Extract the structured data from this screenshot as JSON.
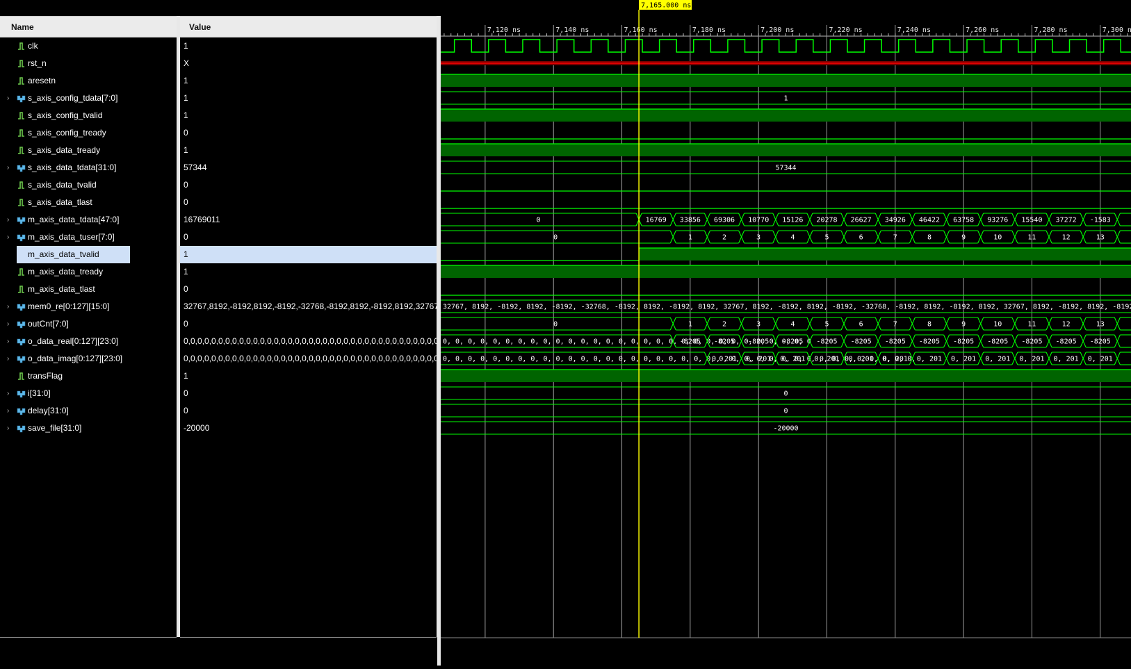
{
  "columns": {
    "name": "Name",
    "value": "Value"
  },
  "cursor": {
    "time": 7165,
    "label": "7,165.000 ns"
  },
  "time_axis": {
    "start": 7107,
    "end": 7309,
    "unit": "ns",
    "major_ticks": [
      {
        "t": 7120,
        "label": "7,120 ns"
      },
      {
        "t": 7140,
        "label": "7,140 ns"
      },
      {
        "t": 7160,
        "label": "7,160 ns"
      },
      {
        "t": 7180,
        "label": "7,180 ns"
      },
      {
        "t": 7200,
        "label": "7,200 ns"
      },
      {
        "t": 7220,
        "label": "7,220 ns"
      },
      {
        "t": 7240,
        "label": "7,240 ns"
      },
      {
        "t": 7260,
        "label": "7,260 ns"
      },
      {
        "t": 7280,
        "label": "7,280 ns"
      },
      {
        "t": 7300,
        "label": "7,300 ns"
      }
    ]
  },
  "colors": {
    "wave": "#00ff00",
    "high_fill": "#006400",
    "unknown": "#ff0000",
    "cursor": "#ffff00",
    "selection": "#cfe0f7"
  },
  "signals": [
    {
      "name": "clk",
      "value": "1",
      "kind": "bit",
      "expandable": false,
      "wave": {
        "type": "clock",
        "period": 10,
        "first_rise": 7111
      }
    },
    {
      "name": "rst_n",
      "value": "X",
      "kind": "bit",
      "expandable": false,
      "wave": {
        "type": "unknown"
      }
    },
    {
      "name": "aresetn",
      "value": "1",
      "kind": "bit",
      "expandable": false,
      "wave": {
        "type": "level",
        "segments": [
          {
            "t": 7107,
            "v": 1
          }
        ]
      }
    },
    {
      "name": "s_axis_config_tdata[7:0]",
      "value": "1",
      "kind": "bus",
      "expandable": true,
      "wave": {
        "type": "bus",
        "segments": [
          {
            "t": 7107,
            "label": "1"
          }
        ]
      }
    },
    {
      "name": "s_axis_config_tvalid",
      "value": "1",
      "kind": "bit",
      "expandable": false,
      "wave": {
        "type": "level",
        "segments": [
          {
            "t": 7107,
            "v": 1
          }
        ]
      }
    },
    {
      "name": "s_axis_config_tready",
      "value": "0",
      "kind": "bit",
      "expandable": false,
      "wave": {
        "type": "level",
        "segments": [
          {
            "t": 7107,
            "v": 0
          }
        ]
      }
    },
    {
      "name": "s_axis_data_tready",
      "value": "1",
      "kind": "bit",
      "expandable": false,
      "wave": {
        "type": "level",
        "segments": [
          {
            "t": 7107,
            "v": 1
          }
        ]
      }
    },
    {
      "name": "s_axis_data_tdata[31:0]",
      "value": "57344",
      "kind": "bus",
      "expandable": true,
      "wave": {
        "type": "bus",
        "segments": [
          {
            "t": 7107,
            "label": "57344"
          }
        ]
      }
    },
    {
      "name": "s_axis_data_tvalid",
      "value": "0",
      "kind": "bit",
      "expandable": false,
      "wave": {
        "type": "level",
        "segments": [
          {
            "t": 7107,
            "v": 0
          }
        ]
      }
    },
    {
      "name": "s_axis_data_tlast",
      "value": "0",
      "kind": "bit",
      "expandable": false,
      "wave": {
        "type": "level",
        "segments": [
          {
            "t": 7107,
            "v": 0
          }
        ]
      }
    },
    {
      "name": "m_axis_data_tdata[47:0]",
      "value": "16769011",
      "kind": "bus",
      "expandable": true,
      "wave": {
        "type": "bus",
        "segments": [
          {
            "t": 7107,
            "label": "0"
          },
          {
            "t": 7165,
            "label": "16769"
          },
          {
            "t": 7175,
            "label": "33856"
          },
          {
            "t": 7185,
            "label": "69306"
          },
          {
            "t": 7195,
            "label": "10770"
          },
          {
            "t": 7205,
            "label": "15126"
          },
          {
            "t": 7215,
            "label": "20278"
          },
          {
            "t": 7225,
            "label": "26627"
          },
          {
            "t": 7235,
            "label": "34926"
          },
          {
            "t": 7245,
            "label": "46422"
          },
          {
            "t": 7255,
            "label": "63758"
          },
          {
            "t": 7265,
            "label": "93276"
          },
          {
            "t": 7275,
            "label": "15540"
          },
          {
            "t": 7285,
            "label": "37272"
          },
          {
            "t": 7295,
            "label": "-1583"
          },
          {
            "t": 7305,
            "label": ""
          }
        ]
      }
    },
    {
      "name": "m_axis_data_tuser[7:0]",
      "value": "0",
      "kind": "bus",
      "expandable": true,
      "wave": {
        "type": "bus",
        "segments": [
          {
            "t": 7107,
            "label": "0"
          },
          {
            "t": 7175,
            "label": "1"
          },
          {
            "t": 7185,
            "label": "2"
          },
          {
            "t": 7195,
            "label": "3"
          },
          {
            "t": 7205,
            "label": "4"
          },
          {
            "t": 7215,
            "label": "5"
          },
          {
            "t": 7225,
            "label": "6"
          },
          {
            "t": 7235,
            "label": "7"
          },
          {
            "t": 7245,
            "label": "8"
          },
          {
            "t": 7255,
            "label": "9"
          },
          {
            "t": 7265,
            "label": "10"
          },
          {
            "t": 7275,
            "label": "11"
          },
          {
            "t": 7285,
            "label": "12"
          },
          {
            "t": 7295,
            "label": "13"
          },
          {
            "t": 7305,
            "label": ""
          }
        ]
      }
    },
    {
      "name": "m_axis_data_tvalid",
      "value": "1",
      "kind": "bit",
      "expandable": false,
      "selected": true,
      "wave": {
        "type": "level",
        "segments": [
          {
            "t": 7107,
            "v": 0
          },
          {
            "t": 7165,
            "v": 1
          }
        ]
      }
    },
    {
      "name": "m_axis_data_tready",
      "value": "1",
      "kind": "bit",
      "expandable": false,
      "wave": {
        "type": "level",
        "segments": [
          {
            "t": 7107,
            "v": 1
          }
        ]
      }
    },
    {
      "name": "m_axis_data_tlast",
      "value": "0",
      "kind": "bit",
      "expandable": false,
      "wave": {
        "type": "level",
        "segments": [
          {
            "t": 7107,
            "v": 0
          }
        ]
      }
    },
    {
      "name": "mem0_re[0:127][15:0]",
      "value": "32767,8192,-8192,8192,-8192,-32768,-8192,8192,-8192,8192,32767,8192,-8192,8192,-8192,-32768",
      "kind": "bus",
      "expandable": true,
      "wave": {
        "type": "bus",
        "segments": [
          {
            "t": 7107,
            "label": "32767, 8192, -8192, 8192, -8192, -32768, -8192, 8192, -8192, 8192, 32767, 8192, -8192, 8192, -8192, -32768, -8192, 8192, -8192, 8192, 32767, 8192, -8192, 8192, -8192, -32768, -8192, 8192, -81"
          }
        ]
      }
    },
    {
      "name": "outCnt[7:0]",
      "value": "0",
      "kind": "bus",
      "expandable": true,
      "wave": {
        "type": "bus",
        "segments": [
          {
            "t": 7107,
            "label": "0"
          },
          {
            "t": 7175,
            "label": "1"
          },
          {
            "t": 7185,
            "label": "2"
          },
          {
            "t": 7195,
            "label": "3"
          },
          {
            "t": 7205,
            "label": "4"
          },
          {
            "t": 7215,
            "label": "5"
          },
          {
            "t": 7225,
            "label": "6"
          },
          {
            "t": 7235,
            "label": "7"
          },
          {
            "t": 7245,
            "label": "8"
          },
          {
            "t": 7255,
            "label": "9"
          },
          {
            "t": 7265,
            "label": "10"
          },
          {
            "t": 7275,
            "label": "11"
          },
          {
            "t": 7285,
            "label": "12"
          },
          {
            "t": 7295,
            "label": "13"
          },
          {
            "t": 7305,
            "label": ""
          }
        ]
      }
    },
    {
      "name": "o_data_real[0:127][23:0]",
      "value": "0,0,0,0,0,0,0,0,0,0,0,0,0,0,0,0,0,0,0,0,0,0,0,0,0,0,0,0,0,0,0,0,0,0,0,0,0,0,0,0",
      "kind": "bus",
      "expandable": true,
      "wave": {
        "type": "bus",
        "segments": [
          {
            "t": 7107,
            "label": "0, 0, 0, 0, 0, 0, 0, 0, 0, 0, 0, 0, 0, 0, 0, 0, 0, 0, 0, 0, 0, 0, 0, 0, 0, 0, 0, 0, 0, 0"
          },
          {
            "t": 7175,
            "label": "-8205"
          },
          {
            "t": 7185,
            "label": "-8205"
          },
          {
            "t": 7195,
            "label": "-8205"
          },
          {
            "t": 7205,
            "label": "-8205"
          },
          {
            "t": 7215,
            "label": "-8205"
          },
          {
            "t": 7225,
            "label": "-8205"
          },
          {
            "t": 7235,
            "label": "-8205"
          },
          {
            "t": 7245,
            "label": "-8205"
          },
          {
            "t": 7255,
            "label": "-8205"
          },
          {
            "t": 7265,
            "label": "-8205"
          },
          {
            "t": 7275,
            "label": "-8205"
          },
          {
            "t": 7285,
            "label": "-8205"
          },
          {
            "t": 7295,
            "label": "-8205"
          },
          {
            "t": 7305,
            "label": ""
          }
        ]
      }
    },
    {
      "name": "o_data_imag[0:127][23:0]",
      "value": "0,0,0,0,0,0,0,0,0,0,0,0,0,0,0,0,0,0,0,0,0,0,0,0,0,0,0,0,0,0,0,0,0,0,0,0,0,0,0,0",
      "kind": "bus",
      "expandable": true,
      "wave": {
        "type": "bus",
        "segments": [
          {
            "t": 7107,
            "label": "0, 0, 0, 0, 0, 0, 0, 0, 0, 0, 0, 0, 0, 0, 0, 0, 0, 0, 0, 0, 0, 0, 0, 0, 0, 0, 0, 0, 0, 0, 0, 0, 0, 0, 0, 0, 0, 0,"
          },
          {
            "t": 7185,
            "label": "0, 201"
          },
          {
            "t": 7195,
            "label": "0, 201"
          },
          {
            "t": 7205,
            "label": "0, 201"
          },
          {
            "t": 7215,
            "label": "0, 201"
          },
          {
            "t": 7225,
            "label": "0, 201"
          },
          {
            "t": 7235,
            "label": "0, 201"
          },
          {
            "t": 7245,
            "label": "0, 201"
          },
          {
            "t": 7255,
            "label": "0, 201"
          },
          {
            "t": 7265,
            "label": "0, 201"
          },
          {
            "t": 7275,
            "label": "0, 201"
          },
          {
            "t": 7285,
            "label": "0, 201"
          },
          {
            "t": 7295,
            "label": "0, 201"
          },
          {
            "t": 7305,
            "label": ""
          }
        ]
      }
    },
    {
      "name": "transFlag",
      "value": "1",
      "kind": "bit",
      "expandable": false,
      "wave": {
        "type": "level",
        "segments": [
          {
            "t": 7107,
            "v": 1
          }
        ]
      }
    },
    {
      "name": "i[31:0]",
      "value": "0",
      "kind": "bus",
      "expandable": true,
      "wave": {
        "type": "bus",
        "segments": [
          {
            "t": 7107,
            "label": "0"
          }
        ]
      }
    },
    {
      "name": "delay[31:0]",
      "value": "0",
      "kind": "bus",
      "expandable": true,
      "wave": {
        "type": "bus",
        "segments": [
          {
            "t": 7107,
            "label": "0"
          }
        ]
      }
    },
    {
      "name": "save_file[31:0]",
      "value": "-20000",
      "kind": "bus",
      "expandable": true,
      "wave": {
        "type": "bus",
        "segments": [
          {
            "t": 7107,
            "label": "-20000"
          }
        ]
      }
    }
  ]
}
